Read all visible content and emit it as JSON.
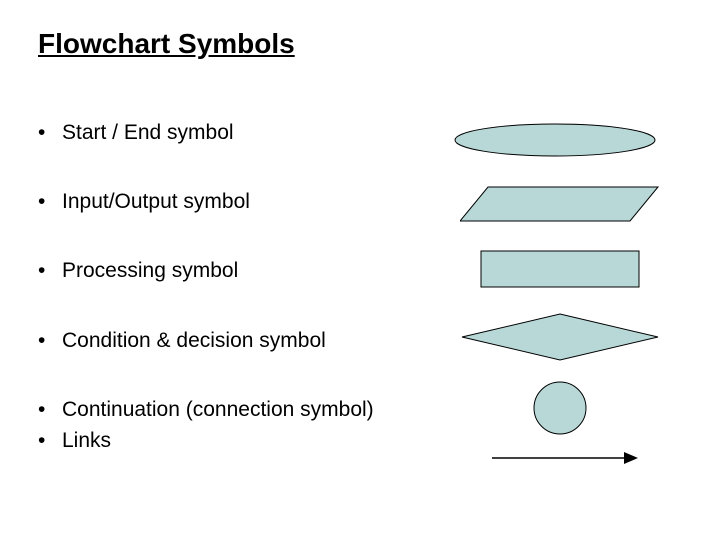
{
  "title": "Flowchart Symbols",
  "bullets": [
    {
      "label": "Start / End symbol"
    },
    {
      "label": "Input/Output symbol"
    },
    {
      "label": "Processing symbol"
    },
    {
      "label": "Condition & decision symbol"
    },
    {
      "label": "Continuation (connection symbol)"
    },
    {
      "label": "Links"
    }
  ],
  "shapes": {
    "fill": "#b8d8d8",
    "stroke": "#000000"
  }
}
